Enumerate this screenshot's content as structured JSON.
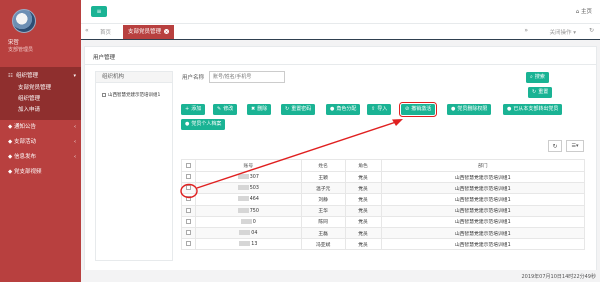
{
  "sidebar": {
    "user_name": "宋哲",
    "user_role": "支部管理员",
    "items": [
      {
        "label": "组织管理",
        "expanded": true,
        "children": [
          "支部党员管理",
          "组织管理",
          "加入申请"
        ]
      },
      {
        "label": "通知公告"
      },
      {
        "label": "支部活动"
      },
      {
        "label": "信息发布"
      },
      {
        "label": "党支部视频"
      }
    ]
  },
  "topbar": {
    "home_label": "主页"
  },
  "tabs": {
    "home": "首页",
    "active": "支部党员管理",
    "close_ops": "关闭操作"
  },
  "page": {
    "title": "用户管理",
    "org_header": "组织机构",
    "org_node": "山西智慧党建示范培训组1",
    "search_label": "用户名称",
    "search_placeholder": "账号/姓名/手机号",
    "search_button": "搜索",
    "reset_button": "重置"
  },
  "buttons": {
    "add": "添加",
    "edit": "修改",
    "delete": "删除",
    "reset_pwd": "重置密码",
    "assign_role": "角色分配",
    "import": "导入",
    "cancel_activation": "撤销激活",
    "party_fee": "党员删除权限",
    "branch_transfer": "已从本支部转出党员",
    "personal_file": "党员个人档案"
  },
  "table": {
    "headers": [
      "账号",
      "姓名",
      "角色",
      "部门"
    ],
    "rows": [
      {
        "account": "307",
        "name": "王颖",
        "role": "党员",
        "dept": "山西智慧党建示范培训组1"
      },
      {
        "account": "503",
        "name": "温子元",
        "role": "党员",
        "dept": "山西智慧党建示范培训组1"
      },
      {
        "account": "464",
        "name": "刘静",
        "role": "党员",
        "dept": "山西智慧党建示范培训组1"
      },
      {
        "account": "750",
        "name": "王华",
        "role": "党员",
        "dept": "山西智慧党建示范培训组1"
      },
      {
        "account": "0",
        "name": "陈同",
        "role": "党员",
        "dept": "山西智慧党建示范培训组1"
      },
      {
        "account": "04",
        "name": "王磊",
        "role": "党员",
        "dept": "山西智慧党建示范培训组1"
      },
      {
        "account": "13",
        "name": "冯亚斌",
        "role": "党员",
        "dept": "山西智慧党建示范培训组1"
      }
    ]
  },
  "status": {
    "timestamp": "2019年07月10日14时22分49秒"
  },
  "colors": {
    "sidebar": "#b8403f",
    "accent": "#1ab394",
    "annotation": "#e02020"
  }
}
